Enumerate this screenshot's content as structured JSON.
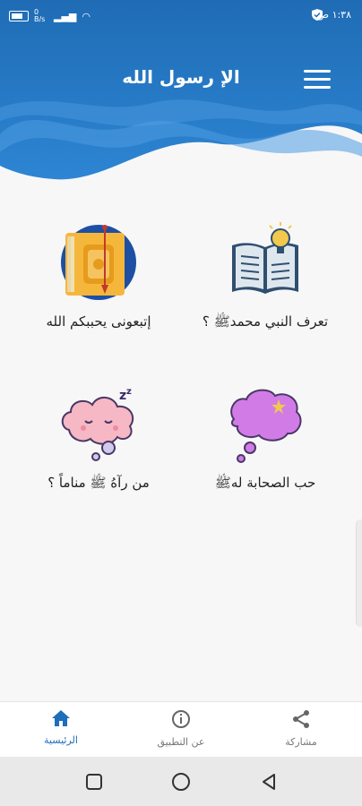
{
  "status": {
    "time": "١:٣٨ ص",
    "speed": "0 B/s"
  },
  "header": {
    "title": "الإ رسول الله"
  },
  "cards": [
    {
      "label": "إتبعونى يحببكم الله",
      "icon": "quran-book-icon"
    },
    {
      "label": "تعرف النبي محمدﷺ ؟",
      "icon": "open-book-lightbulb-icon"
    },
    {
      "label": "من رآهُ ﷺ مناماً ؟",
      "icon": "sleeping-cloud-icon"
    },
    {
      "label": "حب الصحابة لهﷺ",
      "icon": "moon-star-cloud-icon"
    }
  ],
  "bottom_nav": {
    "home": "الرئيسية",
    "about": "عن التطبيق",
    "share": "مشاركة"
  },
  "colors": {
    "primary": "#1e6fb9",
    "header_dark": "#2a7cc8"
  }
}
